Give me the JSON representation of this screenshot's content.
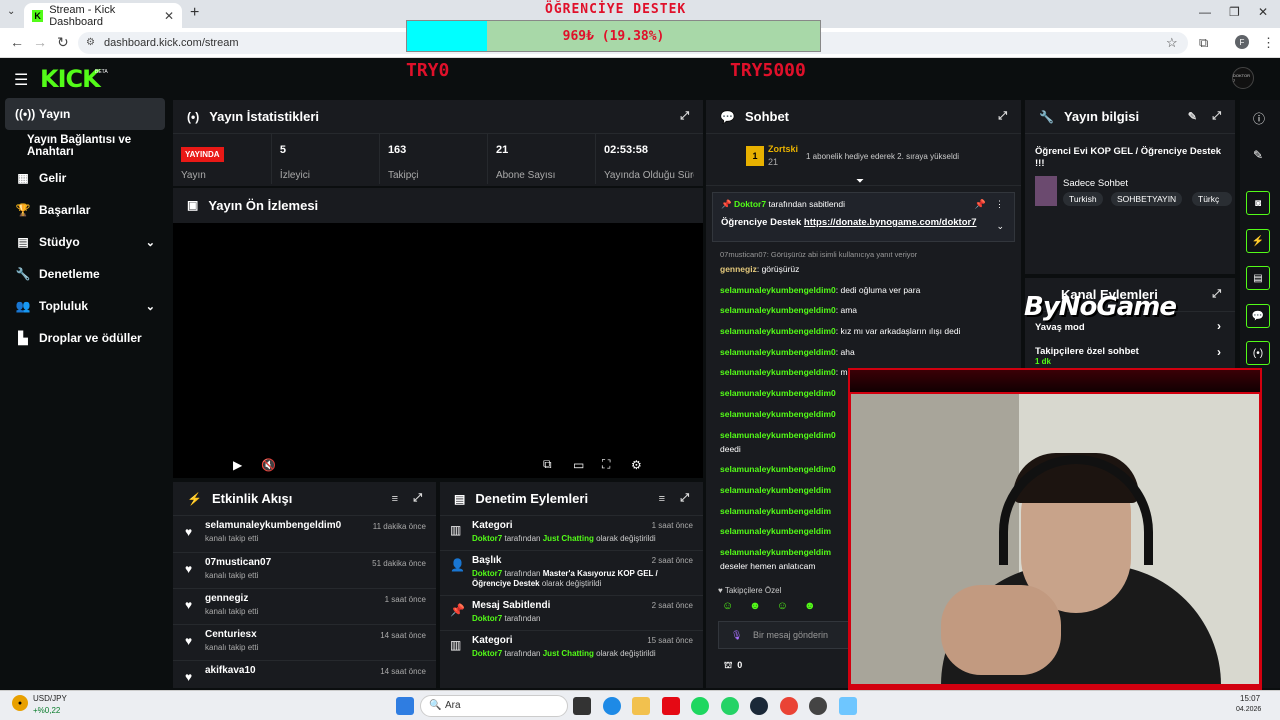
{
  "browser": {
    "tab_title": "Stream - Kick Dashboard",
    "url": "dashboard.kick.com/stream",
    "profile_initial": "F"
  },
  "overlay": {
    "title": "ÖĞRENCİYE DESTEK",
    "progress_text": "969₺ (19.38%)",
    "progress_fraction": 0.1938,
    "goal_start": "TRY0",
    "goal_end": "TRY5000",
    "sponsor": "ByNoGame"
  },
  "kick": {
    "logo": "KICK",
    "beta": "BETA",
    "avatar_text": "DOKTOR 7"
  },
  "sidebar": {
    "items": [
      {
        "label": "Yayın",
        "icon": "broadcast-icon"
      },
      {
        "label": "Yayın Bağlantısı ve Anahtarı",
        "icon": ""
      },
      {
        "label": "Gelir",
        "icon": "revenue-icon"
      },
      {
        "label": "Başarılar",
        "icon": "trophy-icon"
      },
      {
        "label": "Stüdyo",
        "icon": "studio-icon"
      },
      {
        "label": "Denetleme",
        "icon": "wrench-icon"
      },
      {
        "label": "Topluluk",
        "icon": "community-icon"
      },
      {
        "label": "Droplar ve ödüller",
        "icon": "drops-icon"
      }
    ]
  },
  "stats_panel": {
    "title": "Yayın İstatistikleri",
    "live_badge": "YAYINDA",
    "stats": [
      {
        "value": "",
        "label": "Yayın"
      },
      {
        "value": "5",
        "label": "İzleyici"
      },
      {
        "value": "163",
        "label": "Takipçi"
      },
      {
        "value": "21",
        "label": "Abone Sayısı"
      },
      {
        "value": "02:53:58",
        "label": "Yayında Olduğu Süre"
      }
    ]
  },
  "preview_panel": {
    "title": "Yayın Ön İzlemesi"
  },
  "events_panel": {
    "title": "Etkinlik Akışı",
    "items": [
      {
        "name": "selamunaleykumbengeldim0",
        "sub": "kanalı takip etti",
        "time": "11 dakika önce"
      },
      {
        "name": "07mustican07",
        "sub": "kanalı takip etti",
        "time": "51 dakika önce"
      },
      {
        "name": "gennegiz",
        "sub": "kanalı takip etti",
        "time": "1 saat önce"
      },
      {
        "name": "Centuriesx",
        "sub": "kanalı takip etti",
        "time": "14 saat önce"
      },
      {
        "name": "akifkava10",
        "sub": "",
        "time": "14 saat önce"
      }
    ]
  },
  "mod_panel": {
    "title": "Denetim Eylemleri",
    "items": [
      {
        "name": "Kategori",
        "user": "Doktor7",
        "mid": "tarafından",
        "target": "Just Chatting",
        "end": "olarak değiştirildi",
        "time": "1 saat önce"
      },
      {
        "name": "Başlık",
        "user": "Doktor7",
        "mid": "tarafından",
        "target": "Master'a Kasıyoruz KOP GEL / Öğrenciye Destek",
        "end": "olarak değiştirildi",
        "time": "2 saat önce"
      },
      {
        "name": "Mesaj Sabitlendi",
        "user": "Doktor7",
        "mid": "tarafından",
        "target": "",
        "end": "",
        "time": "2 saat önce"
      },
      {
        "name": "Kategori",
        "user": "Doktor7",
        "mid": "tarafından",
        "target": "Just Chatting",
        "end": "olarak değiştirildi",
        "time": "15 saat önce"
      }
    ]
  },
  "chat": {
    "title": "Sohbet",
    "gift_rank": "1",
    "gift_user": "Zortski",
    "gift_count": "21",
    "gift_text": "1 abonelik hediye ederek 2. sıraya yükseldi",
    "pinned_by_user": "Doktor7",
    "pinned_by_text": "tarafından sabitlendi",
    "pinned_prefix": "Öğrenciye Destek",
    "pinned_link": "https://donate.bynogame.com/doktor7",
    "reply_hint": "07mustican07: Görüşürüz abi isimli kullanıcıya yanıt veriyor",
    "messages": [
      {
        "user": "gennegiz",
        "text": "görüşürüz"
      },
      {
        "user": "selamunaleykumbengeldim0",
        "text": "dedi oğluma ver para"
      },
      {
        "user": "selamunaleykumbengeldim0",
        "text": "ama"
      },
      {
        "user": "selamunaleykumbengeldim0",
        "text": "kız mı var arkadaşların ılışı dedi"
      },
      {
        "user": "selamunaleykumbengeldim0",
        "text": "aha"
      },
      {
        "user": "selamunaleykumbengeldim0",
        "text": "mesai"
      },
      {
        "user": "selamunaleykumbengeldim0",
        "text": ""
      },
      {
        "user": "selamunaleykumbengeldim0",
        "text": ""
      },
      {
        "user": "selamunaleykumbengeldim0",
        "text": ""
      },
      {
        "user": "",
        "text": "deedi"
      },
      {
        "user": "selamunaleykumbengeldim0",
        "text": ""
      },
      {
        "user": "selamunaleykumbengeldim",
        "text": ""
      },
      {
        "user": "selamunaleykumbengeldim",
        "text": ""
      },
      {
        "user": "selamunaleykumbengeldim",
        "text": ""
      },
      {
        "user": "selamunaleykumbengeldim",
        "text": ""
      },
      {
        "user": "",
        "text": "deseler hemen anlatıcam"
      }
    ],
    "followers_only": "Takipçilere Özel",
    "input_placeholder": "Bir mesaj gönderin",
    "points": "0"
  },
  "info_panel": {
    "title": "Yayın bilgisi",
    "stream_title": "Öğrenci Evi KOP GEL / Öğrenciye Destek !!!",
    "category": "Sadece Sohbet",
    "tags": [
      "Turkish",
      "SOHBETYAYIN",
      "Türkç"
    ]
  },
  "channel_actions": {
    "title": "Kanal Eylemleri",
    "items": [
      {
        "label": "Yavaş mod",
        "sub": ""
      },
      {
        "label": "Takipçilere özel sohbet",
        "sub": "1 dk"
      }
    ]
  },
  "taskbar": {
    "ticker": "USD/JPY",
    "ticker_change": "+%0,22",
    "search": "Ara",
    "time": "15:07",
    "date": "04.2026"
  }
}
